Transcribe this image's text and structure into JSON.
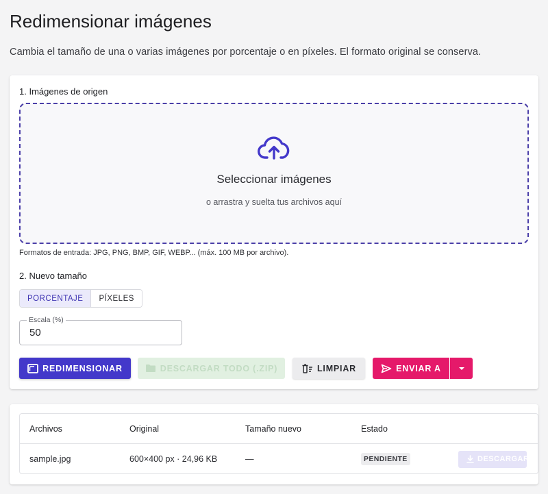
{
  "header": {
    "title": "Redimensionar imágenes",
    "description": "Cambia el tamaño de una o varias imágenes por porcentaje o en píxeles. El formato original se conserva."
  },
  "source": {
    "section_label": "1. Imágenes de origen",
    "drop_title": "Seleccionar imágenes",
    "drop_subtitle": "o arrastra y suelta tus archivos aquí",
    "formats_note": "Formatos de entrada: JPG, PNG, BMP, GIF, WEBP... (máx. 100 MB por archivo).",
    "upload_icon": "cloud-upload-icon"
  },
  "resize": {
    "section_label": "2. Nuevo tamaño",
    "modes": [
      {
        "label": "PORCENTAJE",
        "active": true
      },
      {
        "label": "PÍXELES",
        "active": false
      }
    ],
    "scale_label": "Escala (%)",
    "scale_value": "50"
  },
  "actions": {
    "resize_label": "REDIMENSIONAR",
    "download_all_label": "DESCARGAR TODO (.ZIP)",
    "clear_label": "LIMPIAR",
    "send_label": "ENVIAR A"
  },
  "table": {
    "columns": [
      "Archivos",
      "Original",
      "Tamaño nuevo",
      "Estado"
    ],
    "rows": [
      {
        "file": "sample.jpg",
        "original": "600×400 px · 24,96 KB",
        "new_size": "—",
        "status": "PENDIENTE",
        "download_label": "DESCARGAR"
      }
    ]
  },
  "colors": {
    "primary": "#4338ca",
    "accent": "#e5196a",
    "dropzone_border": "#4b3fa8"
  }
}
